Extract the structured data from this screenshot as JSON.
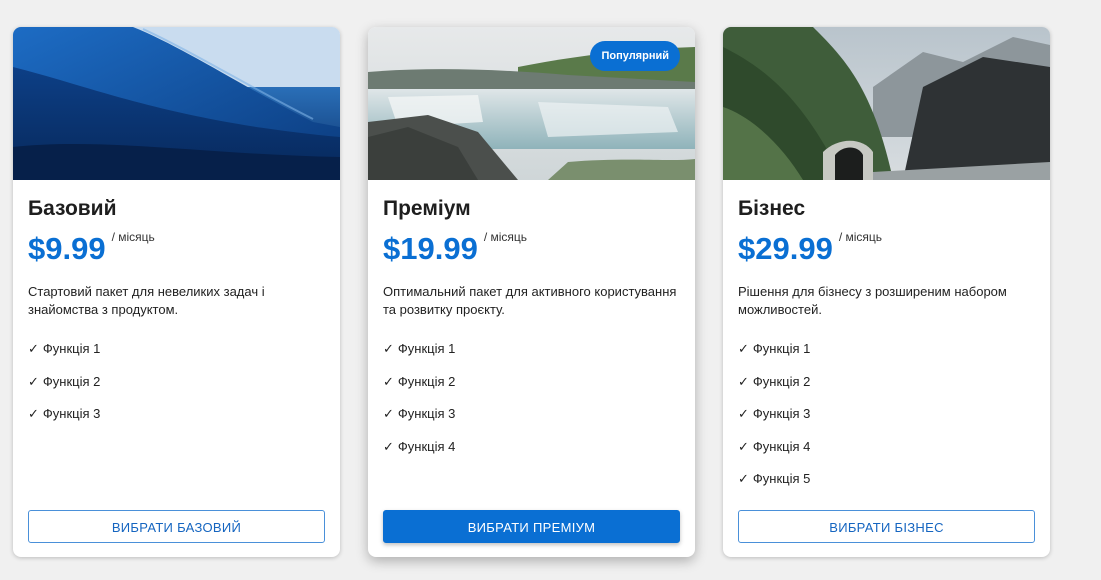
{
  "plans": [
    {
      "title": "Базовий",
      "price": "$9.99",
      "period": "/ місяць",
      "description": "Стартовий пакет для невеликих задач і знайомства з продуктом.",
      "features": [
        "Функція 1",
        "Функція 2",
        "Функція 3"
      ],
      "button_label": "ВИБРАТИ БАЗОВИЙ",
      "image": "ocean-wave-photo"
    },
    {
      "title": "Преміум",
      "price": "$19.99",
      "period": "/ місяць",
      "description": "Оптимальний пакет для активного користування та розвитку проєкту.",
      "features": [
        "Функція 1",
        "Функція 2",
        "Функція 3",
        "Функція 4"
      ],
      "button_label": "ВИБРАТИ ПРЕМІУМ",
      "badge": "Популярний",
      "image": "waterfall-photo"
    },
    {
      "title": "Бізнес",
      "price": "$29.99",
      "period": "/ місяць",
      "description": "Рішення для бізнесу з розширеним набором можливостей.",
      "features": [
        "Функція 1",
        "Функція 2",
        "Функція 3",
        "Функція 4",
        "Функція 5"
      ],
      "button_label": "ВИБРАТИ БІЗНЕС",
      "image": "mountain-tunnel-photo"
    }
  ],
  "check_symbol": "✓",
  "colors": {
    "accent": "#0a6fd3",
    "background": "#f0f0f0",
    "card": "#ffffff"
  }
}
